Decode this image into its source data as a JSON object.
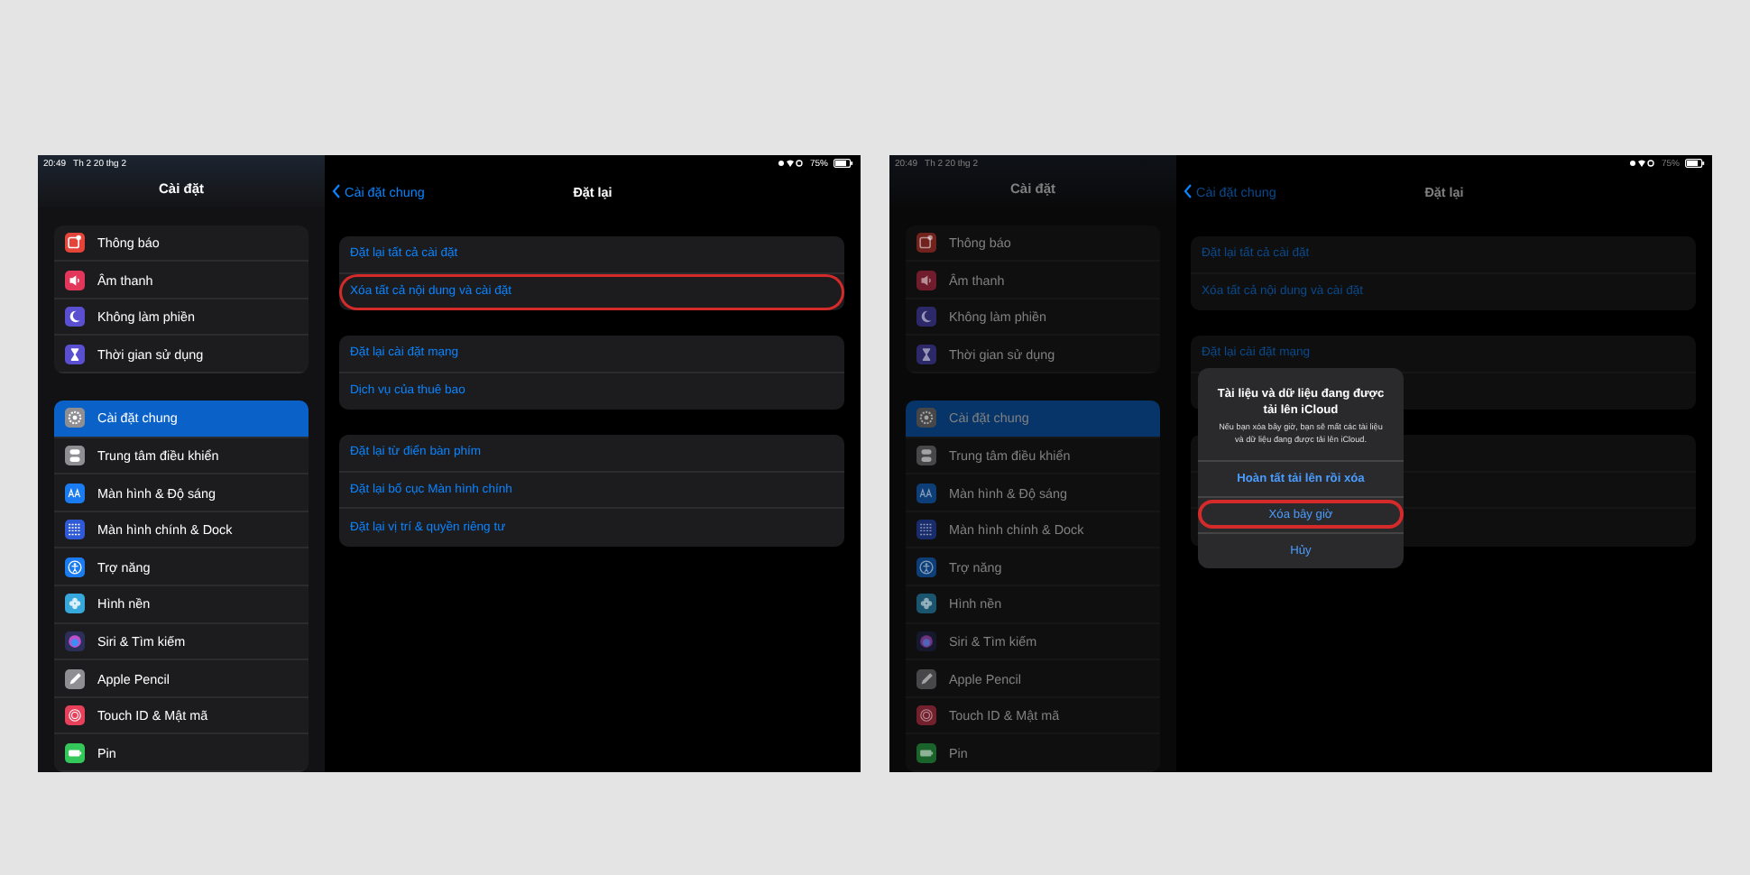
{
  "screens": [
    {
      "dimmed": false,
      "status_bar": {
        "time": "20:49",
        "date": "Th 2 20 thg 2",
        "battery": "75%"
      },
      "sidebar": {
        "title": "Cài đặt",
        "groups": [
          [
            {
              "label": "Thông báo",
              "kind": "notification",
              "color": "#e5443a",
              "selected": false
            },
            {
              "label": "Âm thanh",
              "kind": "sound",
              "color": "#e2375a",
              "selected": false
            },
            {
              "label": "Không làm phiền",
              "kind": "moon",
              "color": "#5a4fd1",
              "selected": false
            },
            {
              "label": "Thời gian sử dụng",
              "kind": "hourglass",
              "color": "#5a4fd1",
              "selected": false
            }
          ],
          [
            {
              "label": "Cài đặt chung",
              "kind": "gear",
              "color": "#8e8e93",
              "selected": true
            },
            {
              "label": "Trung tâm điều khiển",
              "kind": "switches",
              "color": "#8e8e93",
              "selected": false
            },
            {
              "label": "Màn hình & Độ sáng",
              "kind": "letters",
              "color": "#1a7cf0",
              "selected": false
            },
            {
              "label": "Màn hình chính & Dock",
              "kind": "grid",
              "color": "#3059d6",
              "selected": false
            },
            {
              "label": "Trợ năng",
              "kind": "person",
              "color": "#1a7cf0",
              "selected": false
            },
            {
              "label": "Hình nền",
              "kind": "flower",
              "color": "#36a8dc",
              "selected": false
            },
            {
              "label": "Siri & Tìm kiếm",
              "kind": "orb",
              "color": "#2c2f5a",
              "selected": false
            },
            {
              "label": "Apple Pencil",
              "kind": "pencil",
              "color": "#8e8e93",
              "selected": false
            },
            {
              "label": "Touch ID & Mật mã",
              "kind": "fingerprint",
              "color": "#e6405a",
              "selected": false
            },
            {
              "label": "Pin",
              "kind": "battery",
              "color": "#34c759",
              "selected": false
            }
          ]
        ]
      },
      "detail": {
        "back": "Cài đặt chung",
        "title": "Đặt lại",
        "groups": [
          [
            {
              "kind": "option",
              "label": "Đặt lại tất cả cài đặt",
              "circled": false
            },
            {
              "kind": "option",
              "label": "Xóa tất cả nội dung và cài đặt",
              "circled": true
            }
          ],
          [
            {
              "kind": "option",
              "label": "Đặt lại cài đặt mạng",
              "circled": false
            },
            {
              "kind": "option",
              "label": "Dịch vụ của thuê bao",
              "circled": false
            }
          ],
          [
            {
              "kind": "option",
              "label": "Đặt lại từ điển bàn phím",
              "circled": false
            },
            {
              "kind": "option",
              "label": "Đặt lại bố cục Màn hình chính",
              "circled": false
            },
            {
              "kind": "option",
              "label": "Đặt lại vị trí & quyền riêng tư",
              "circled": false
            }
          ]
        ]
      }
    },
    {
      "dimmed": true,
      "status_bar": {
        "time": "20:49",
        "date": "Th 2 20 thg 2",
        "battery": "75%"
      },
      "sidebar": {
        "title": "Cài đặt",
        "groups": [
          [
            {
              "label": "Thông báo",
              "kind": "notification",
              "color": "#72221d",
              "selected": false
            },
            {
              "label": "Âm thanh",
              "kind": "sound",
              "color": "#711c2d",
              "selected": false
            },
            {
              "label": "Không làm phiền",
              "kind": "moon",
              "color": "#2d2868",
              "selected": false
            },
            {
              "label": "Thời gian sử dụng",
              "kind": "hourglass",
              "color": "#2d2868",
              "selected": false
            }
          ],
          [
            {
              "label": "Cài đặt chung",
              "kind": "gear",
              "color": "#474749",
              "selected": true
            },
            {
              "label": "Trung tâm điều khiển",
              "kind": "switches",
              "color": "#474749",
              "selected": false
            },
            {
              "label": "Màn hình & Độ sáng",
              "kind": "letters",
              "color": "#0d3e78",
              "selected": false
            },
            {
              "label": "Màn hình chính & Dock",
              "kind": "grid",
              "color": "#182c6b",
              "selected": false
            },
            {
              "label": "Trợ năng",
              "kind": "person",
              "color": "#0d3e78",
              "selected": false
            },
            {
              "label": "Hình nền",
              "kind": "flower",
              "color": "#1b546e",
              "selected": false
            },
            {
              "label": "Siri & Tìm kiếm",
              "kind": "orb",
              "color": "#16182d",
              "selected": false
            },
            {
              "label": "Apple Pencil",
              "kind": "pencil",
              "color": "#474749",
              "selected": false
            },
            {
              "label": "Touch ID & Mật mã",
              "kind": "fingerprint",
              "color": "#73202d",
              "selected": false
            },
            {
              "label": "Pin",
              "kind": "battery",
              "color": "#1a642c",
              "selected": false
            }
          ]
        ]
      },
      "detail": {
        "back": "Cài đặt chung",
        "title": "Đặt lại",
        "groups": [
          [
            {
              "kind": "option",
              "label": "Đặt lại tất cả cài đặt",
              "circled": false
            },
            {
              "kind": "option",
              "label": "Xóa tất cả nội dung và cài đặt",
              "circled": false
            }
          ],
          [
            {
              "kind": "option",
              "label": "Đặt lại cài đặt mạng",
              "circled": false
            },
            {
              "kind": "covered"
            }
          ],
          [
            {
              "kind": "covered"
            },
            {
              "kind": "covered"
            },
            {
              "kind": "covered"
            }
          ]
        ]
      },
      "alert": {
        "title": "Tài liệu và dữ liệu đang được tải lên iCloud",
        "message": "Nếu bạn xóa bây giờ, bạn sẽ mất các tài liệu và dữ liệu đang được tải lên iCloud.",
        "buttons": [
          {
            "label": "Hoàn tất tải lên rồi xóa",
            "circled": false
          },
          {
            "label": "Xóa bây giờ",
            "circled": true
          },
          {
            "label": "Hủy",
            "circled": false
          }
        ]
      }
    }
  ]
}
